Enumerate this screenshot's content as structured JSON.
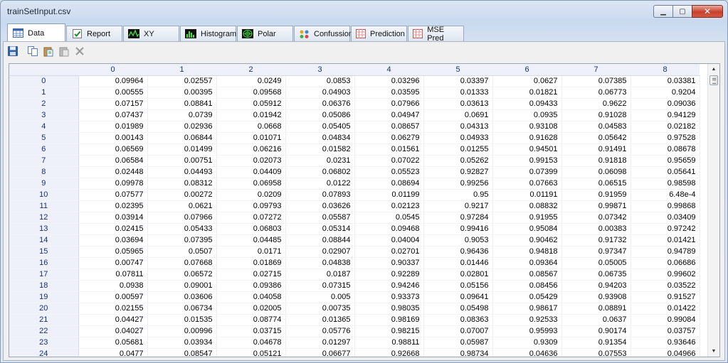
{
  "window": {
    "title": "trainSetInput.csv",
    "minimize": "▁",
    "maximize": "▢",
    "close": "✕"
  },
  "tabs": [
    {
      "label": "Data",
      "icon": "table-grid-icon",
      "active": true
    },
    {
      "label": "Report",
      "icon": "checkmark-icon"
    },
    {
      "label": "XY",
      "icon": "line-graph-icon"
    },
    {
      "label": "Histogram",
      "icon": "bar-chart-icon"
    },
    {
      "label": "Polar",
      "icon": "polar-plot-icon"
    },
    {
      "label": "Confussion",
      "icon": "confusion-matrix-icon"
    },
    {
      "label": "Prediction",
      "icon": "prediction-grid-icon"
    },
    {
      "label": "MSE Pred",
      "icon": "mse-grid-icon"
    }
  ],
  "toolbar": [
    "save-icon",
    "copy-icon",
    "paste-special-icon",
    "paste-icon",
    "delete-icon"
  ],
  "grid": {
    "columns": [
      "0",
      "1",
      "2",
      "3",
      "4",
      "5",
      "6",
      "7",
      "8"
    ],
    "rows": [
      {
        "index": "0",
        "cells": [
          "0.09964",
          "0.02557",
          "0.0249",
          "0.0853",
          "0.03296",
          "0.03397",
          "0.0627",
          "0.07385",
          "0.03381"
        ]
      },
      {
        "index": "1",
        "cells": [
          "0.00555",
          "0.00395",
          "0.09568",
          "0.04903",
          "0.03595",
          "0.01333",
          "0.01821",
          "0.06773",
          "0.9204"
        ]
      },
      {
        "index": "2",
        "cells": [
          "0.07157",
          "0.08841",
          "0.05912",
          "0.06376",
          "0.07966",
          "0.03613",
          "0.09433",
          "0.9622",
          "0.09036"
        ]
      },
      {
        "index": "3",
        "cells": [
          "0.07437",
          "0.0739",
          "0.01942",
          "0.05086",
          "0.04947",
          "0.0691",
          "0.0935",
          "0.91028",
          "0.94129"
        ]
      },
      {
        "index": "4",
        "cells": [
          "0.01989",
          "0.02936",
          "0.0668",
          "0.05405",
          "0.08657",
          "0.04313",
          "0.93108",
          "0.04583",
          "0.02182"
        ]
      },
      {
        "index": "5",
        "cells": [
          "0.00143",
          "0.06844",
          "0.01071",
          "0.04834",
          "0.06279",
          "0.04933",
          "0.91628",
          "0.05642",
          "0.97528"
        ]
      },
      {
        "index": "6",
        "cells": [
          "0.06569",
          "0.01499",
          "0.06216",
          "0.01582",
          "0.01561",
          "0.01255",
          "0.94501",
          "0.91491",
          "0.08678"
        ]
      },
      {
        "index": "7",
        "cells": [
          "0.06584",
          "0.00751",
          "0.02073",
          "0.0231",
          "0.07022",
          "0.05262",
          "0.99153",
          "0.91818",
          "0.95659"
        ]
      },
      {
        "index": "8",
        "cells": [
          "0.02448",
          "0.04493",
          "0.04409",
          "0.06802",
          "0.05523",
          "0.92827",
          "0.07399",
          "0.06098",
          "0.05641"
        ]
      },
      {
        "index": "9",
        "cells": [
          "0.09978",
          "0.08312",
          "0.06958",
          "0.0122",
          "0.08694",
          "0.99256",
          "0.07663",
          "0.06515",
          "0.98598"
        ]
      },
      {
        "index": "10",
        "cells": [
          "0.07577",
          "0.00272",
          "0.0209",
          "0.07893",
          "0.01199",
          "0.95",
          "0.01191",
          "0.91959",
          "6.48e-4"
        ]
      },
      {
        "index": "11",
        "cells": [
          "0.02395",
          "0.0621",
          "0.09793",
          "0.03626",
          "0.02123",
          "0.9217",
          "0.08832",
          "0.99871",
          "0.99868"
        ]
      },
      {
        "index": "12",
        "cells": [
          "0.03914",
          "0.07966",
          "0.07272",
          "0.05587",
          "0.0545",
          "0.97284",
          "0.91955",
          "0.07342",
          "0.03409"
        ]
      },
      {
        "index": "13",
        "cells": [
          "0.02415",
          "0.05433",
          "0.06803",
          "0.05314",
          "0.09468",
          "0.99416",
          "0.95084",
          "0.00383",
          "0.97242"
        ]
      },
      {
        "index": "14",
        "cells": [
          "0.03694",
          "0.07395",
          "0.04485",
          "0.08844",
          "0.04004",
          "0.9053",
          "0.90462",
          "0.91732",
          "0.01421"
        ]
      },
      {
        "index": "15",
        "cells": [
          "0.05965",
          "0.0507",
          "0.0171",
          "0.02907",
          "0.02701",
          "0.96436",
          "0.94818",
          "0.97347",
          "0.94789"
        ]
      },
      {
        "index": "16",
        "cells": [
          "0.00747",
          "0.07668",
          "0.01869",
          "0.04838",
          "0.90337",
          "0.01446",
          "0.09364",
          "0.05005",
          "0.06686"
        ]
      },
      {
        "index": "17",
        "cells": [
          "0.07811",
          "0.06572",
          "0.02715",
          "0.0187",
          "0.92289",
          "0.02801",
          "0.08567",
          "0.06735",
          "0.99602"
        ]
      },
      {
        "index": "18",
        "cells": [
          "0.0938",
          "0.09001",
          "0.09386",
          "0.07315",
          "0.94246",
          "0.05156",
          "0.08456",
          "0.94203",
          "0.03522"
        ]
      },
      {
        "index": "19",
        "cells": [
          "0.00597",
          "0.03606",
          "0.04058",
          "0.005",
          "0.93373",
          "0.09641",
          "0.05429",
          "0.93908",
          "0.91527"
        ]
      },
      {
        "index": "20",
        "cells": [
          "0.02155",
          "0.06734",
          "0.02005",
          "0.00735",
          "0.98035",
          "0.05498",
          "0.98617",
          "0.08891",
          "0.01422"
        ]
      },
      {
        "index": "21",
        "cells": [
          "0.04427",
          "0.01535",
          "0.08774",
          "0.01365",
          "0.98169",
          "0.08363",
          "0.92533",
          "0.0637",
          "0.99084"
        ]
      },
      {
        "index": "22",
        "cells": [
          "0.04027",
          "0.00996",
          "0.03715",
          "0.05776",
          "0.98215",
          "0.07007",
          "0.95993",
          "0.90174",
          "0.03757"
        ]
      },
      {
        "index": "23",
        "cells": [
          "0.05681",
          "0.03934",
          "0.04678",
          "0.01297",
          "0.98811",
          "0.05987",
          "0.9309",
          "0.91354",
          "0.93646"
        ]
      },
      {
        "index": "24",
        "cells": [
          "0.0477",
          "0.08547",
          "0.05121",
          "0.06677",
          "0.92668",
          "0.98734",
          "0.04636",
          "0.07553",
          "0.04966"
        ]
      }
    ]
  },
  "colors": {
    "header_bg": "#eef0fa",
    "header_text": "#1a2f6e",
    "accent": "#2a7a2a"
  }
}
